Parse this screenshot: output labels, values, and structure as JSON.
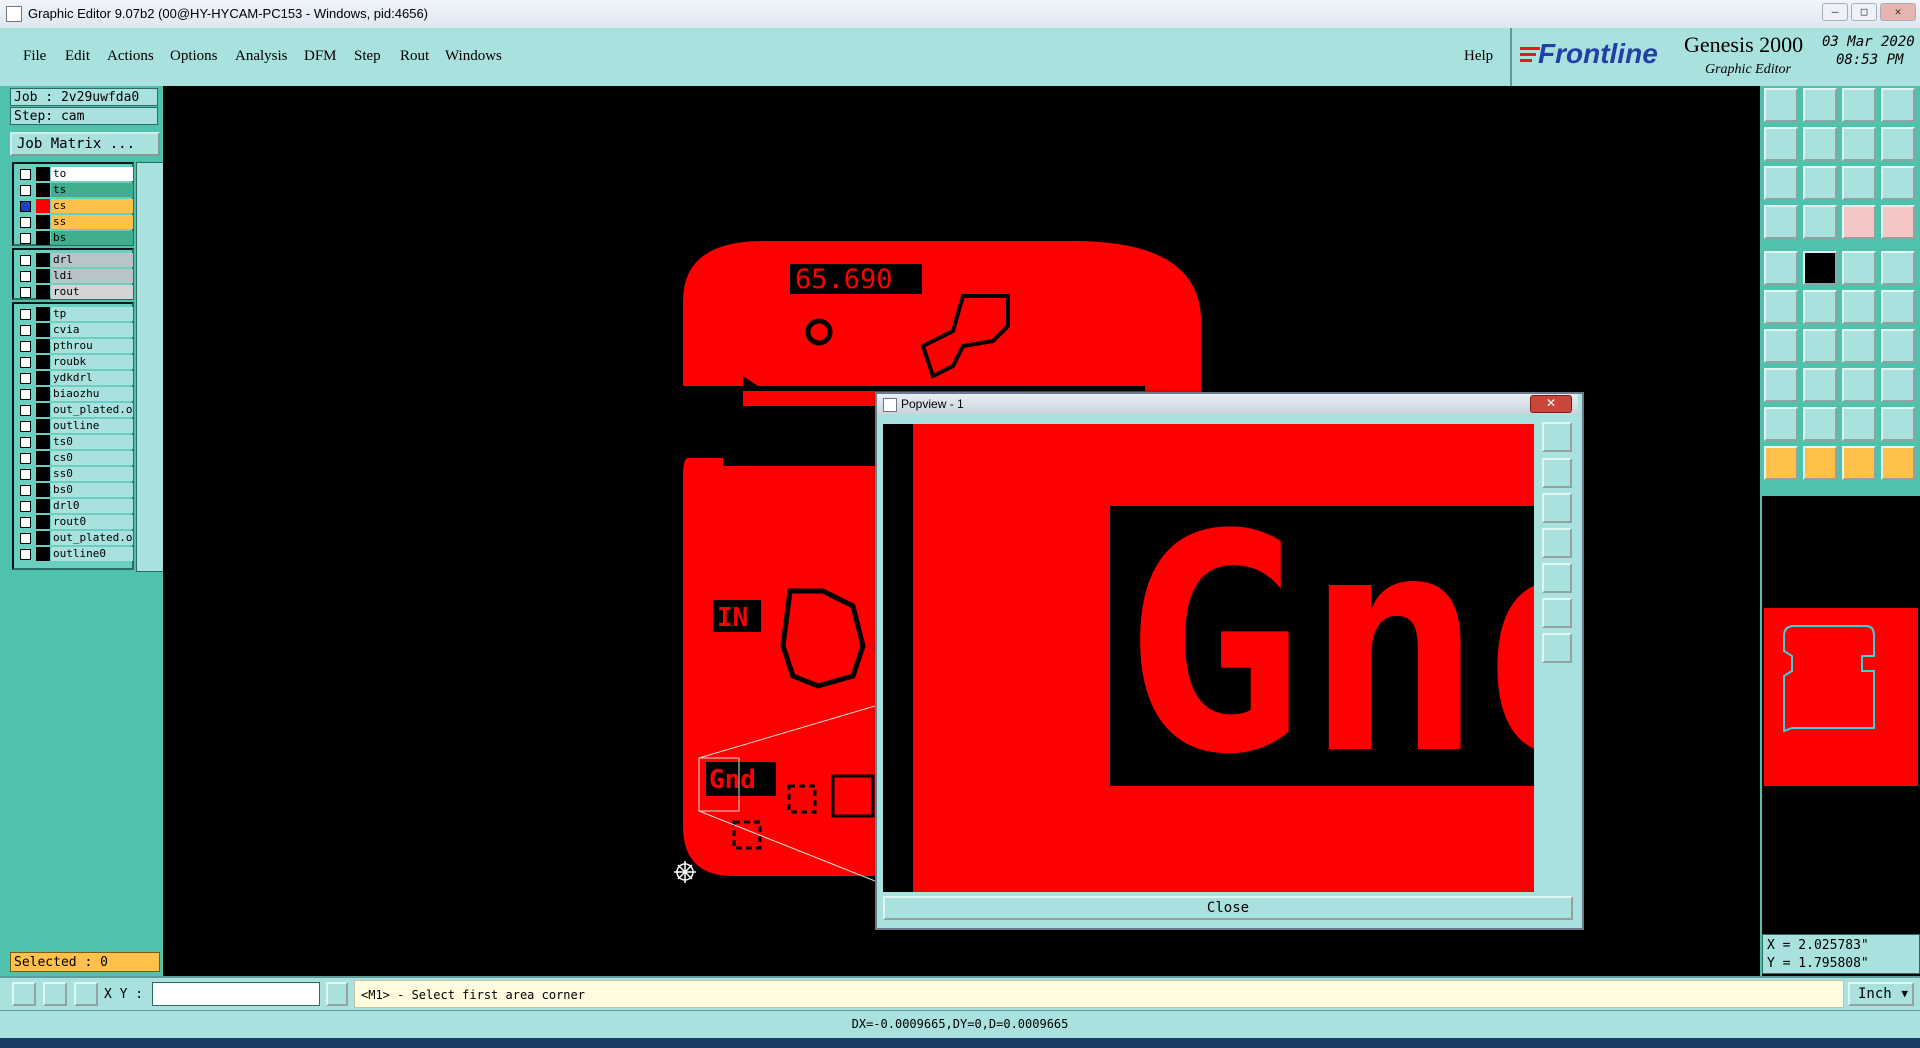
{
  "window": {
    "title": "Graphic Editor 9.07b2 (00@HY-HYCAM-PC153 - Windows, pid:4656)"
  },
  "menu": [
    "File",
    "Edit",
    "Actions",
    "Options",
    "Analysis",
    "DFM",
    "Step",
    "Rout",
    "Windows"
  ],
  "help_label": "Help",
  "brand": {
    "logo": "Frontline",
    "product": "Genesis 2000",
    "subtitle": "Graphic Editor",
    "date": "03 Mar 2020",
    "time": "08:53 PM"
  },
  "job": {
    "job": "Job : 2v29uwfda0",
    "step": "Step: cam",
    "matrix_button": "Job Matrix ..."
  },
  "layers_board": [
    {
      "name": "to",
      "color": "#ffffff"
    },
    {
      "name": "ts",
      "color": "#3fae8f"
    },
    {
      "name": "cs",
      "color": "#ffc14a",
      "active": true
    },
    {
      "name": "ss",
      "color": "#ffc14a"
    },
    {
      "name": "bs",
      "color": "#3fae8f"
    }
  ],
  "layers_drill": [
    {
      "name": "drl",
      "color": "#b8c4c8"
    },
    {
      "name": "ldi",
      "color": "#b8c4c8"
    },
    {
      "name": "rout",
      "color": "#d4d4d4"
    }
  ],
  "layers_misc": [
    "tp",
    "cvia",
    "pthrou",
    "roubk",
    "ydkdrl",
    "biaozhu",
    "out_plated.o",
    "outline",
    "ts0",
    "cs0",
    "ss0",
    "bs0",
    "drl0",
    "rout0",
    "out_plated.o",
    "outline0"
  ],
  "selected": "Selected : 0",
  "board": {
    "label_top": "65.690",
    "label_in": "IN",
    "label_gnd": "Gnd"
  },
  "popview": {
    "title": "Popview - 1",
    "close_label": "Close",
    "zoom_text": "Gnd"
  },
  "coords": {
    "x": "X = 2.025783\"",
    "y": "Y = 1.795808\""
  },
  "command": {
    "xy_label": "X Y :",
    "xy_value": "",
    "prompt": "<M1> - Select first area corner",
    "units": "Inch"
  },
  "status": "DX=-0.0009665,DY=0,D=0.0009665",
  "colors": {
    "panel": "#4fc2ae",
    "bar": "#a8e1dd",
    "board": "#ff0000",
    "highlight": "#ffc14a"
  }
}
